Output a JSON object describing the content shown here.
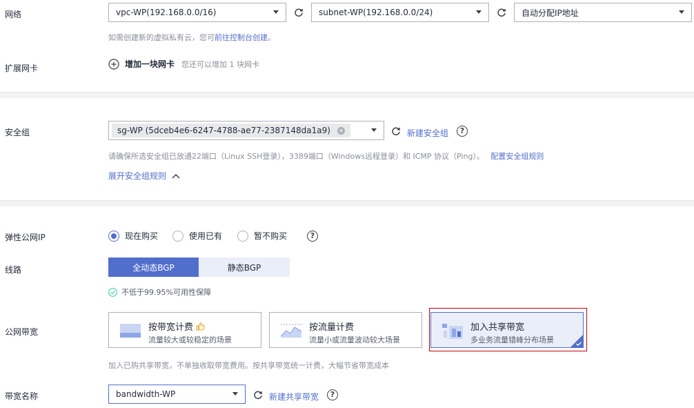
{
  "network": {
    "label": "网络",
    "vpc_value": "vpc-WP(192.168.0.0/16)",
    "subnet_value": "subnet-WP(192.168.0.0/24)",
    "ip_value": "自动分配IP地址",
    "hint_prefix": "如需创建新的虚拟私有云，您可",
    "hint_link": "前往控制台创建",
    "hint_suffix": "。"
  },
  "nic": {
    "label": "扩展网卡",
    "add_label": "增加一块网卡",
    "hint": "您还可以增加 1 块网卡"
  },
  "security_group": {
    "label": "安全组",
    "tag_value": "sg-WP (5dceb4e6-6247-4788-ae77-2387148da1a9)",
    "create_link": "新建安全组",
    "hint": "请确保所选安全组已放通22端口（Linux SSH登录），3389端口（Windows远程登录）和 ICMP 协议（Ping）。",
    "config_link": "配置安全组规则",
    "expand_link": "展开安全组规则"
  },
  "eip": {
    "label": "弹性公网IP",
    "options": [
      "现在购买",
      "使用已有",
      "暂不购买"
    ],
    "selected": "现在购买"
  },
  "line": {
    "label": "线路",
    "options": [
      "全动态BGP",
      "静态BGP"
    ],
    "selected": "全动态BGP",
    "guarantee": "不低于99.95%可用性保障"
  },
  "bandwidth": {
    "label": "公网带宽",
    "cards": [
      {
        "title": "按带宽计费",
        "sub": "流量较大或较稳定的场景"
      },
      {
        "title": "按流量计费",
        "sub": "流量小或流量波动较大场景"
      },
      {
        "title": "加入共享带宽",
        "sub": "多业务流量错峰分布场景"
      }
    ],
    "selected": "加入共享带宽",
    "hint": "加入已购共享带宽，不单独收取带宽费用。按共享带宽统一计费，大幅节省带宽成本"
  },
  "bandwidth_name": {
    "label": "带宽名称",
    "value": "bandwidth-WP",
    "create_link": "新建共享带宽"
  },
  "colors": {
    "accent": "#526ecc",
    "highlight_border": "#c7000b",
    "success": "#50d4ab"
  }
}
